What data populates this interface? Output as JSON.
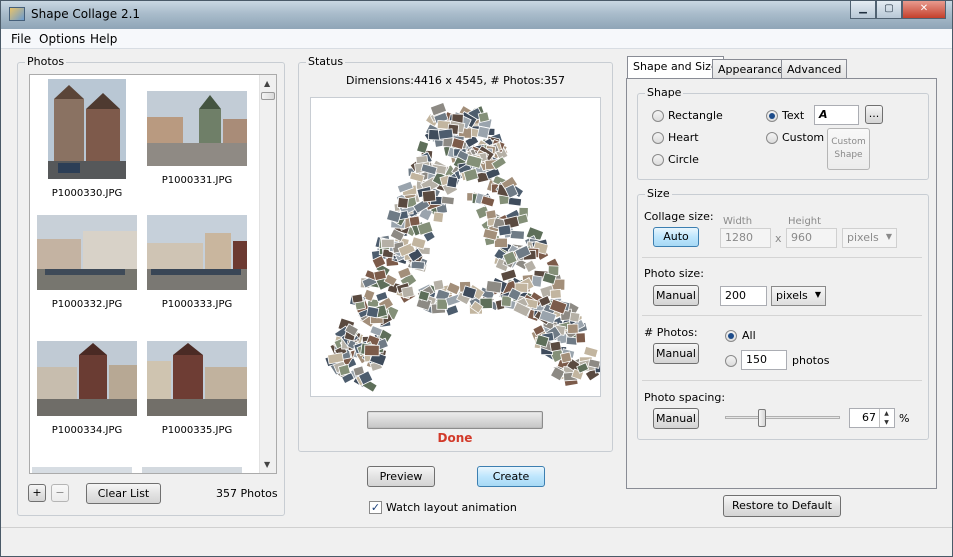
{
  "window": {
    "title": "Shape Collage 2.1",
    "min": "▁",
    "max": "▢",
    "close": "✕"
  },
  "menu": {
    "file": "File",
    "options": "Options",
    "help": "Help"
  },
  "photos": {
    "title": "Photos",
    "items": [
      {
        "name": "P1000330.JPG"
      },
      {
        "name": "P1000331.JPG"
      },
      {
        "name": "P1000332.JPG"
      },
      {
        "name": "P1000333.JPG"
      },
      {
        "name": "P1000334.JPG"
      },
      {
        "name": "P1000335.JPG"
      }
    ],
    "add_label": "+",
    "remove_label": "−",
    "clear_label": "Clear List",
    "count": "357 Photos"
  },
  "status": {
    "title": "Status",
    "dimensions": "Dimensions:4416 x 4545, # Photos:357",
    "progress": 1.0,
    "done": "Done",
    "preview_btn": "Preview",
    "create_btn": "Create",
    "watch_label": "Watch layout animation",
    "watch_checked": true,
    "shape_letter": "A"
  },
  "tabs": {
    "shape_size": "Shape and Size",
    "appearance": "Appearance",
    "advanced": "Advanced"
  },
  "shape": {
    "title": "Shape",
    "rect": "Rectangle",
    "heart": "Heart",
    "circle": "Circle",
    "text": "Text",
    "custom": "Custom",
    "text_value": "A",
    "dots": "...",
    "custom_btn_line1": "Custom",
    "custom_btn_line2": "Shape"
  },
  "size": {
    "title": "Size",
    "collage_label": "Collage size:",
    "auto_btn": "Auto",
    "width_label": "Width",
    "height_label": "Height",
    "width_value": "1280",
    "x": "x",
    "height_value": "960",
    "units": "pixels",
    "photo_size_label": "Photo size:",
    "photo_manual_btn": "Manual",
    "photo_size_value": "200",
    "photo_units": "pixels",
    "nphotos_label": "# Photos:",
    "nphotos_manual_btn": "Manual",
    "all_label": "All",
    "count_value": "150",
    "count_units": "photos",
    "spacing_label": "Photo spacing:",
    "spacing_manual_btn": "Manual",
    "spacing_value": "67",
    "spacing_units": "%",
    "spacing_slider": 0.3
  },
  "restore_btn": "Restore to Default",
  "colors": {
    "accent": "#3c7fb1",
    "done": "#d23a2a"
  }
}
